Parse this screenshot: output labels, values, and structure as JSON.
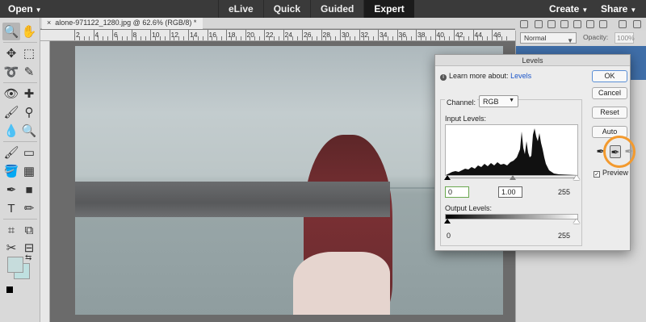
{
  "menubar": {
    "open": "Open",
    "modes": [
      "eLive",
      "Quick",
      "Guided",
      "Expert"
    ],
    "active_mode": "Expert",
    "create": "Create",
    "share": "Share"
  },
  "document": {
    "tab_title": "alone-971122_1280.jpg @ 62.6% (RGB/8) *",
    "close": "×"
  },
  "ruler": {
    "labels": [
      "2",
      "4",
      "6",
      "8",
      "10",
      "12",
      "14",
      "16",
      "18",
      "20",
      "22",
      "24",
      "26",
      "28",
      "30",
      "32",
      "34",
      "36",
      "38",
      "40",
      "42",
      "44",
      "46"
    ]
  },
  "layers_panel": {
    "blend_mode": "Normal",
    "opacity_label": "Opacity:",
    "opacity_value": "100%"
  },
  "levels_dialog": {
    "title": "Levels",
    "learn_prefix": "Learn more about:",
    "learn_link": "Levels",
    "channel_label": "Channel:",
    "channel_value": "RGB",
    "input_levels_label": "Input Levels:",
    "input_black": "0",
    "input_gamma": "1.00",
    "input_white": "255",
    "output_levels_label": "Output Levels:",
    "output_black": "0",
    "output_white": "255",
    "buttons": {
      "ok": "OK",
      "cancel": "Cancel",
      "reset": "Reset",
      "auto": "Auto"
    },
    "preview_label": "Preview",
    "preview_checked": true
  },
  "colors": {
    "foreground": "#c6dcdc",
    "background": "#bfe0e0",
    "accent_mode": "#1b1b1b",
    "highlight_ring": "#f39a2e",
    "layer_selected": "#3f6ea8"
  },
  "icons": {
    "toolbar": [
      "zoom-icon",
      "hand-icon",
      "move-icon",
      "marquee-icon",
      "lasso-icon",
      "quick-selection-icon",
      "red-eye-icon",
      "spot-healing-icon",
      "smart-brush-icon",
      "clone-stamp-icon",
      "blur-icon",
      "sponge-icon",
      "brush-icon",
      "eraser-icon",
      "paint-bucket-icon",
      "gradient-icon",
      "eyedropper-icon",
      "shape-icon",
      "type-icon",
      "pencil-icon",
      "crop-icon",
      "recompose-icon",
      "straighten-icon",
      "content-move-icon"
    ],
    "droppers": [
      "black-eyedropper-icon",
      "gray-eyedropper-icon",
      "white-eyedropper-icon"
    ]
  }
}
